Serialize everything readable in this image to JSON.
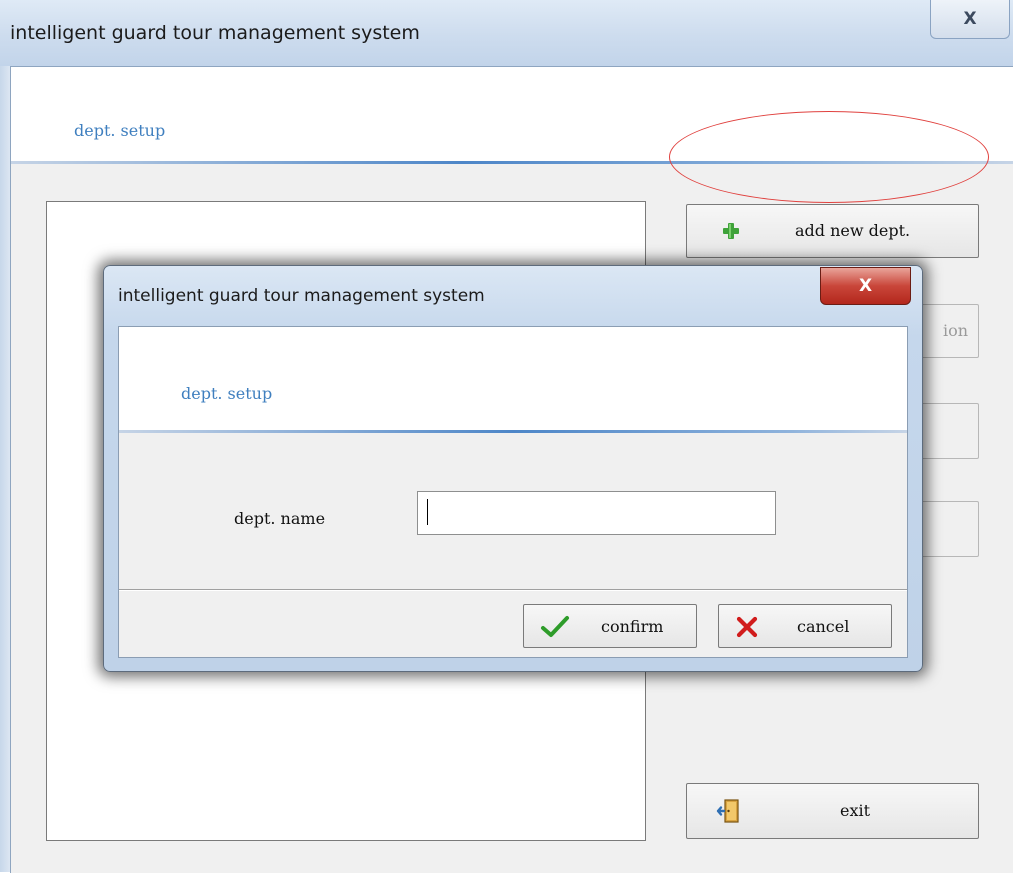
{
  "main_window": {
    "title": "intelligent guard tour management system",
    "header_title": "dept. setup",
    "close_glyph": "X",
    "buttons": {
      "add_new_dept": "add new dept.",
      "partial_label": "ion",
      "exit": "exit"
    },
    "icons": {
      "add": "plus-icon",
      "exit": "exit-door-icon"
    },
    "highlight_color": "#e0413e"
  },
  "dialog": {
    "title": "intelligent guard tour management system",
    "header_title": "dept. setup",
    "close_glyph": "X",
    "field": {
      "label": "dept. name",
      "value": "",
      "placeholder": ""
    },
    "buttons": {
      "confirm": "confirm",
      "cancel": "cancel"
    },
    "icons": {
      "confirm": "checkmark-icon",
      "cancel": "cross-icon"
    },
    "colors": {
      "accent": "#3f7fbf",
      "confirm_icon": "#2e9c2a",
      "cancel_icon": "#d11c1c",
      "close_button": "#c9463a"
    }
  }
}
